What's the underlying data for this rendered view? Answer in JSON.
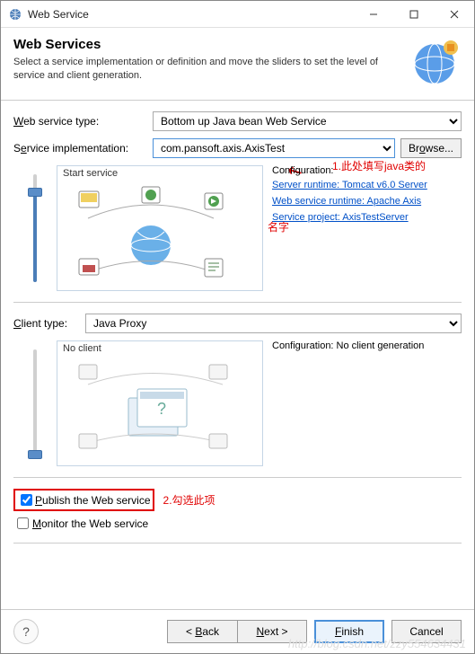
{
  "window": {
    "title": "Web Service"
  },
  "header": {
    "title": "Web Services",
    "description": "Select a service implementation or definition and move the sliders to set the level of service and client generation."
  },
  "form": {
    "serviceTypeLabel": "Web service type:",
    "serviceTypeValue": "Bottom up Java bean Web Service",
    "serviceImplLabel": "Service implementation:",
    "serviceImplValue": "com.pansoft.axis.AxisTest",
    "browseLabel": "Browse...",
    "startServiceTitle": "Start service",
    "configLabel": "Configuration:",
    "serverRuntimeLink": "Server runtime: Tomcat v6.0 Server",
    "wsRuntimeLink": "Web service runtime: Apache Axis",
    "serviceProjectLink": "Service project: AxisTestServer",
    "clientTypeLabel": "Client type:",
    "clientTypeValue": "Java Proxy",
    "noClientTitle": "No client",
    "clientConfigText": "Configuration: No client generation",
    "publishLabel": "Publish the Web service",
    "monitorLabel": "Monitor the Web service"
  },
  "annotations": {
    "note1": "1.此处填写java类的",
    "note1b": "名字",
    "note2": "2.勾选此项"
  },
  "footer": {
    "back": "< Back",
    "next": "Next >",
    "finish": "Finish",
    "cancel": "Cancel"
  },
  "watermark": "http://blog.csdn.net/zzy554634431"
}
